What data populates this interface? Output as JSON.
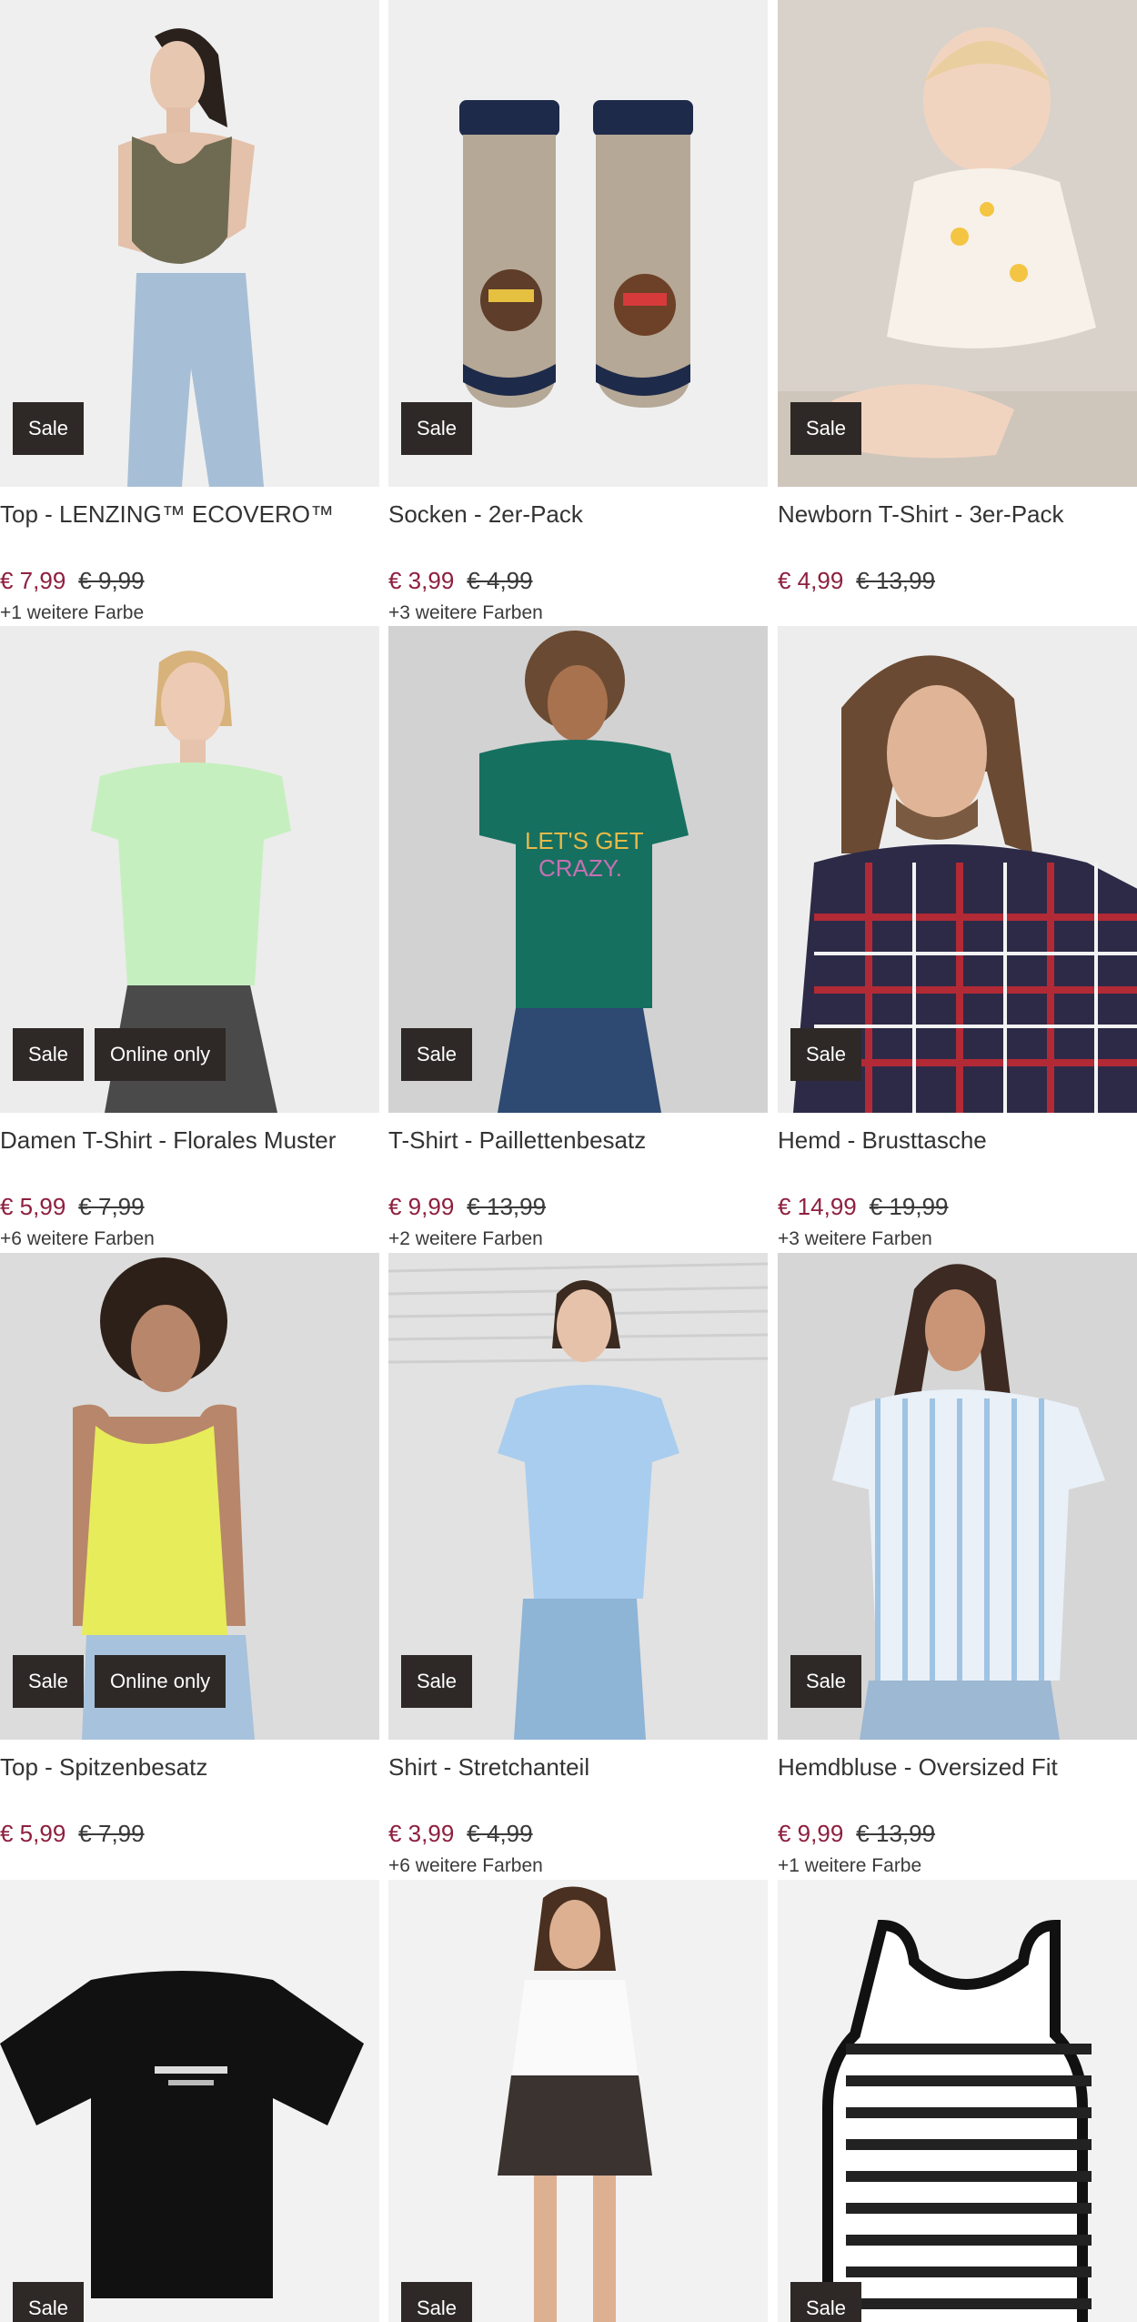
{
  "products": [
    {
      "name": "Top - LENZING™ ECOVERO™",
      "price": "€ 7,99",
      "old_price": "€ 9,99",
      "colors": "+1 weitere Farbe",
      "badges": [
        "Sale"
      ],
      "bg": "#efefef"
    },
    {
      "name": "Socken - 2er-Pack",
      "price": "€ 3,99",
      "old_price": "€ 4,99",
      "colors": "+3 weitere Farben",
      "badges": [
        "Sale"
      ],
      "bg": "#efefef"
    },
    {
      "name": "Newborn T-Shirt - 3er-Pack",
      "price": "€ 4,99",
      "old_price": "€ 13,99",
      "colors": "",
      "badges": [
        "Sale"
      ],
      "bg": "#d8d2cb"
    },
    {
      "name": "Damen T-Shirt - Florales Muster",
      "price": "€ 5,99",
      "old_price": "€ 7,99",
      "colors": "+6 weitere Farben",
      "badges": [
        "Sale",
        "Online only"
      ],
      "bg": "#ececec"
    },
    {
      "name": "T-Shirt - Paillettenbesatz",
      "price": "€ 9,99",
      "old_price": "€ 13,99",
      "colors": "+2 weitere Farben",
      "badges": [
        "Sale"
      ],
      "bg": "#d2d2d2"
    },
    {
      "name": "Hemd - Brusttasche",
      "price": "€ 14,99",
      "old_price": "€ 19,99",
      "colors": "+3 weitere Farben",
      "badges": [
        "Sale"
      ],
      "bg": "#ededed"
    },
    {
      "name": "Top - Spitzenbesatz",
      "price": "€ 5,99",
      "old_price": "€ 7,99",
      "colors": "",
      "badges": [
        "Sale",
        "Online only"
      ],
      "bg": "#dcdcdc"
    },
    {
      "name": "Shirt - Stretchanteil",
      "price": "€ 3,99",
      "old_price": "€ 4,99",
      "colors": "+6 weitere Farben",
      "badges": [
        "Sale"
      ],
      "bg": "#e2e2e2"
    },
    {
      "name": "Hemdbluse - Oversized Fit",
      "price": "€ 9,99",
      "old_price": "€ 13,99",
      "colors": "+1 weitere Farbe",
      "badges": [
        "Sale"
      ],
      "bg": "#d6d6d6"
    },
    {
      "name": "",
      "price": "",
      "old_price": "",
      "colors": "",
      "badges": [
        "Sale"
      ],
      "bg": "#f2f2f2"
    },
    {
      "name": "",
      "price": "",
      "old_price": "",
      "colors": "",
      "badges": [
        "Sale"
      ],
      "bg": "#f2f2f2"
    },
    {
      "name": "",
      "price": "",
      "old_price": "",
      "colors": "",
      "badges": [
        "Sale"
      ],
      "bg": "#f2f2f2"
    }
  ]
}
